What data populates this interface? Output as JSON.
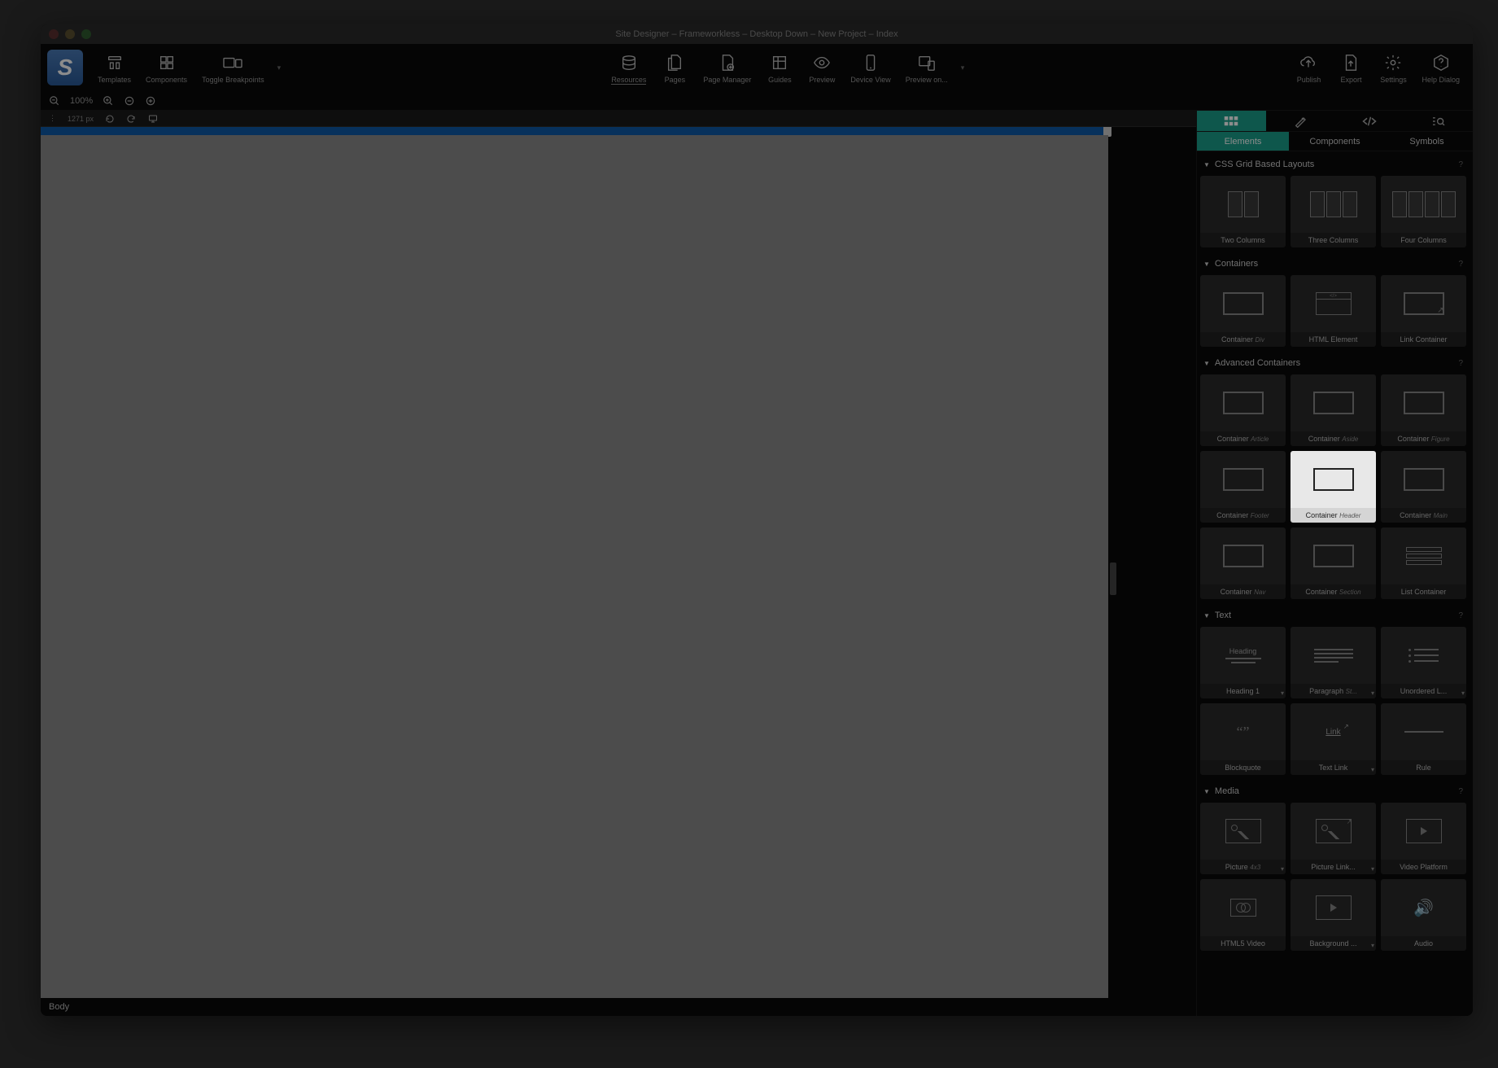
{
  "window": {
    "title": "Site Designer – Frameworkless – Desktop Down – New Project – Index"
  },
  "toolbar": {
    "templates": "Templates",
    "components": "Components",
    "toggle_breakpoints": "Toggle Breakpoints",
    "resources": "Resources",
    "pages": "Pages",
    "page_manager": "Page Manager",
    "guides": "Guides",
    "preview": "Preview",
    "device_view": "Device View",
    "preview_on": "Preview on...",
    "publish": "Publish",
    "export": "Export",
    "settings": "Settings",
    "help_dialog": "Help Dialog"
  },
  "zoom": {
    "level": "100%"
  },
  "ruler": {
    "width_label": "1271 px"
  },
  "status": {
    "path": "Body"
  },
  "panel": {
    "tabs": {
      "elements": "Elements",
      "components": "Components",
      "symbols": "Symbols"
    },
    "sections": {
      "css_grid": {
        "title": "CSS Grid Based Layouts",
        "items": [
          {
            "label": "Two Columns"
          },
          {
            "label": "Three Columns"
          },
          {
            "label": "Four Columns"
          }
        ]
      },
      "containers": {
        "title": "Containers",
        "items": [
          {
            "label": "Container",
            "sub": "Div"
          },
          {
            "label": "HTML Element"
          },
          {
            "label": "Link Container"
          }
        ]
      },
      "advanced_containers": {
        "title": "Advanced Containers",
        "items": [
          {
            "label": "Container",
            "sub": "Article"
          },
          {
            "label": "Container",
            "sub": "Aside"
          },
          {
            "label": "Container",
            "sub": "Figure"
          },
          {
            "label": "Container",
            "sub": "Footer"
          },
          {
            "label": "Container",
            "sub": "Header",
            "highlighted": true
          },
          {
            "label": "Container",
            "sub": "Main"
          },
          {
            "label": "Container",
            "sub": "Nav"
          },
          {
            "label": "Container",
            "sub": "Section"
          },
          {
            "label": "List Container"
          }
        ]
      },
      "text": {
        "title": "Text",
        "items": [
          {
            "label": "Heading 1",
            "dd": true
          },
          {
            "label": "Paragraph",
            "sub": "St...",
            "dd": true
          },
          {
            "label": "Unordered L...",
            "dd": true
          },
          {
            "label": "Blockquote"
          },
          {
            "label": "Text Link",
            "dd": true
          },
          {
            "label": "Rule"
          }
        ]
      },
      "media": {
        "title": "Media",
        "items": [
          {
            "label": "Picture",
            "sub": "4x3",
            "dd": true
          },
          {
            "label": "Picture Link...",
            "dd": true
          },
          {
            "label": "Video Platform"
          },
          {
            "label": "HTML5 Video"
          },
          {
            "label": "Background ...",
            "dd": true
          },
          {
            "label": "Audio"
          }
        ]
      }
    }
  }
}
